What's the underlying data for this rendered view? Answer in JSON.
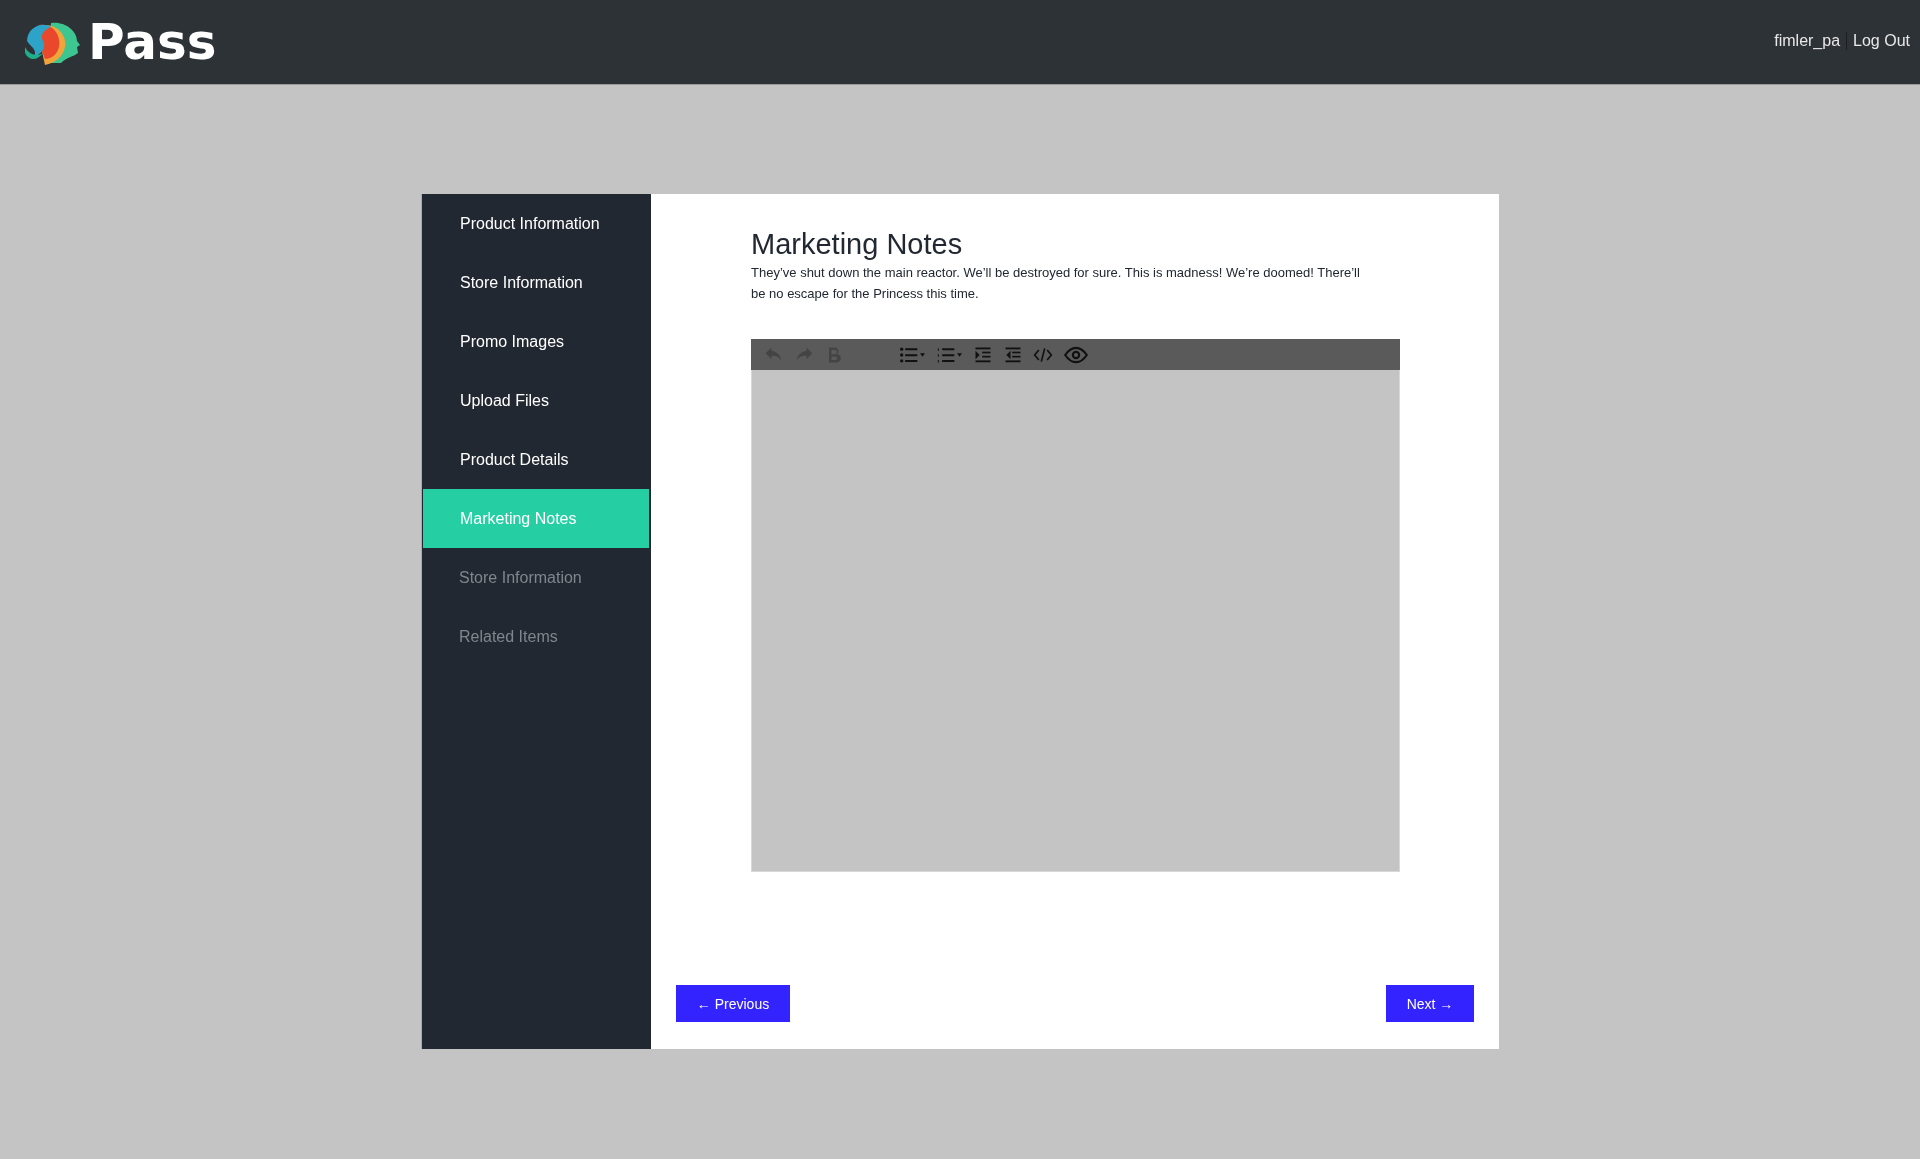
{
  "header": {
    "logo_text": "Pass",
    "user": "fimler_pa",
    "logout": "Log Out"
  },
  "sidebar": {
    "items": [
      {
        "label": "Product Information",
        "selected": false,
        "disabled": false
      },
      {
        "label": "Store Information",
        "selected": false,
        "disabled": false
      },
      {
        "label": "Promo Images",
        "selected": false,
        "disabled": false
      },
      {
        "label": "Upload Files",
        "selected": false,
        "disabled": false
      },
      {
        "label": "Product Details",
        "selected": false,
        "disabled": false
      },
      {
        "label": "Marketing Notes",
        "selected": true,
        "disabled": false
      },
      {
        "label": "Store Information",
        "selected": false,
        "disabled": true
      },
      {
        "label": "Related Items",
        "selected": false,
        "disabled": true
      }
    ]
  },
  "content": {
    "title": "Marketing Notes",
    "description": "They’ve shut down the main reactor. We’ll be destroyed for sure. This is madness! We’re doomed! There’ll be no escape for the Princess this time.",
    "editor": {
      "toolbar": [
        {
          "kind": "undo",
          "disabled": true
        },
        {
          "kind": "redo",
          "disabled": true
        },
        {
          "kind": "bold",
          "disabled": true
        },
        {
          "kind": "bullet-list",
          "disabled": false
        },
        {
          "kind": "numbered-list",
          "disabled": false
        },
        {
          "kind": "indent",
          "disabled": false
        },
        {
          "kind": "outdent",
          "disabled": false
        },
        {
          "kind": "code",
          "disabled": false
        },
        {
          "kind": "preview",
          "disabled": false
        }
      ]
    }
  },
  "footer": {
    "previous": "← Previous",
    "next": "Next →"
  }
}
